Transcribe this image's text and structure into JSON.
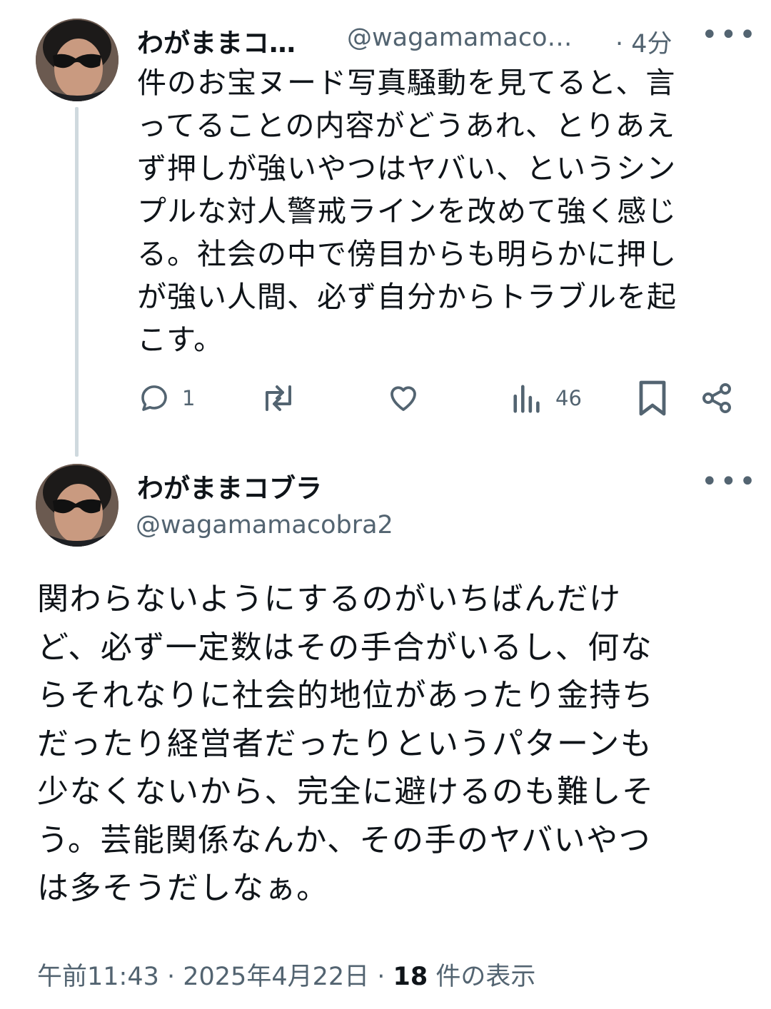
{
  "tweet1": {
    "display_name": "わがままコ…",
    "handle": "@wagamamaco…",
    "time": "· 4分",
    "more_icon": "more-horizontal-icon",
    "text": "件のお宝ヌード写真騒動を見てると、言\nってることの内容がどうあれ、とりあえ\nず押しが強いやつはヤバい、というシン\nプルな対人警戒ラインを改めて強く感じ\nる。社会の中で傍目からも明らかに押し\nが強い人間、必ず自分からトラブルを起\nこす。",
    "actions": {
      "reply_count": "1",
      "views_count": "46"
    }
  },
  "tweet2": {
    "display_name": "わがままコブラ",
    "handle": "@wagamamacobra2",
    "text": "関わらないようにするのがいちばんだけ\nど、必ず一定数はその手合がいるし、何な\nらそれなりに社会的地位があったり金持ち\nだったり経営者だったりというパターンも\n少なくないから、完全に避けるのも難しそ\nう。芸能関係なんか、その手のヤバいやつ\nは多そうだしなぁ。",
    "timestamp": "午前11:43 · 2025年4月22日 · ",
    "views_number": "18",
    "views_label": " 件の表示"
  },
  "colors": {
    "text": "#0f1419",
    "secondary": "#536471",
    "thread_line": "#cfd9de"
  }
}
